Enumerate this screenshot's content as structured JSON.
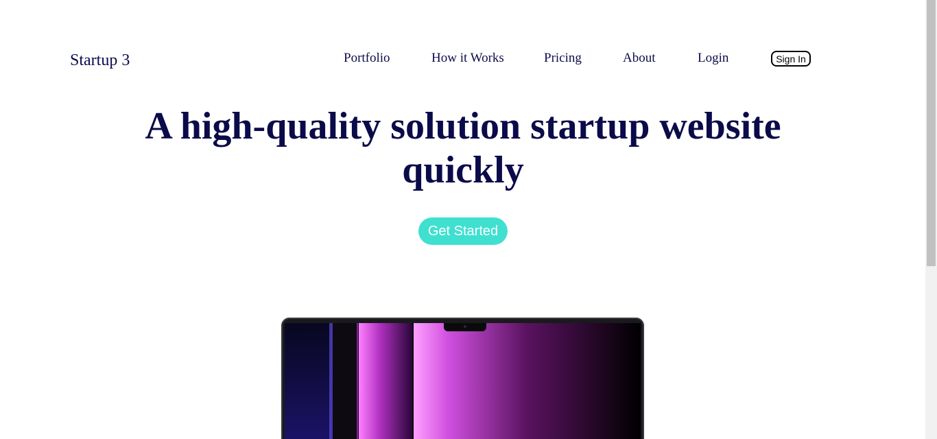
{
  "header": {
    "logo": "Startup 3",
    "nav": [
      {
        "label": "Portfolio"
      },
      {
        "label": "How it Works"
      },
      {
        "label": "Pricing"
      },
      {
        "label": "About"
      },
      {
        "label": "Login"
      }
    ],
    "signin_label": "Sign In"
  },
  "hero": {
    "headline_line1": "A high-quality solution startup website",
    "headline_line2": "quickly",
    "cta_label": "Get Started"
  },
  "colors": {
    "text": "#0b0b4a",
    "accent": "#40e0d0",
    "screen_purple": "#c040e0"
  }
}
